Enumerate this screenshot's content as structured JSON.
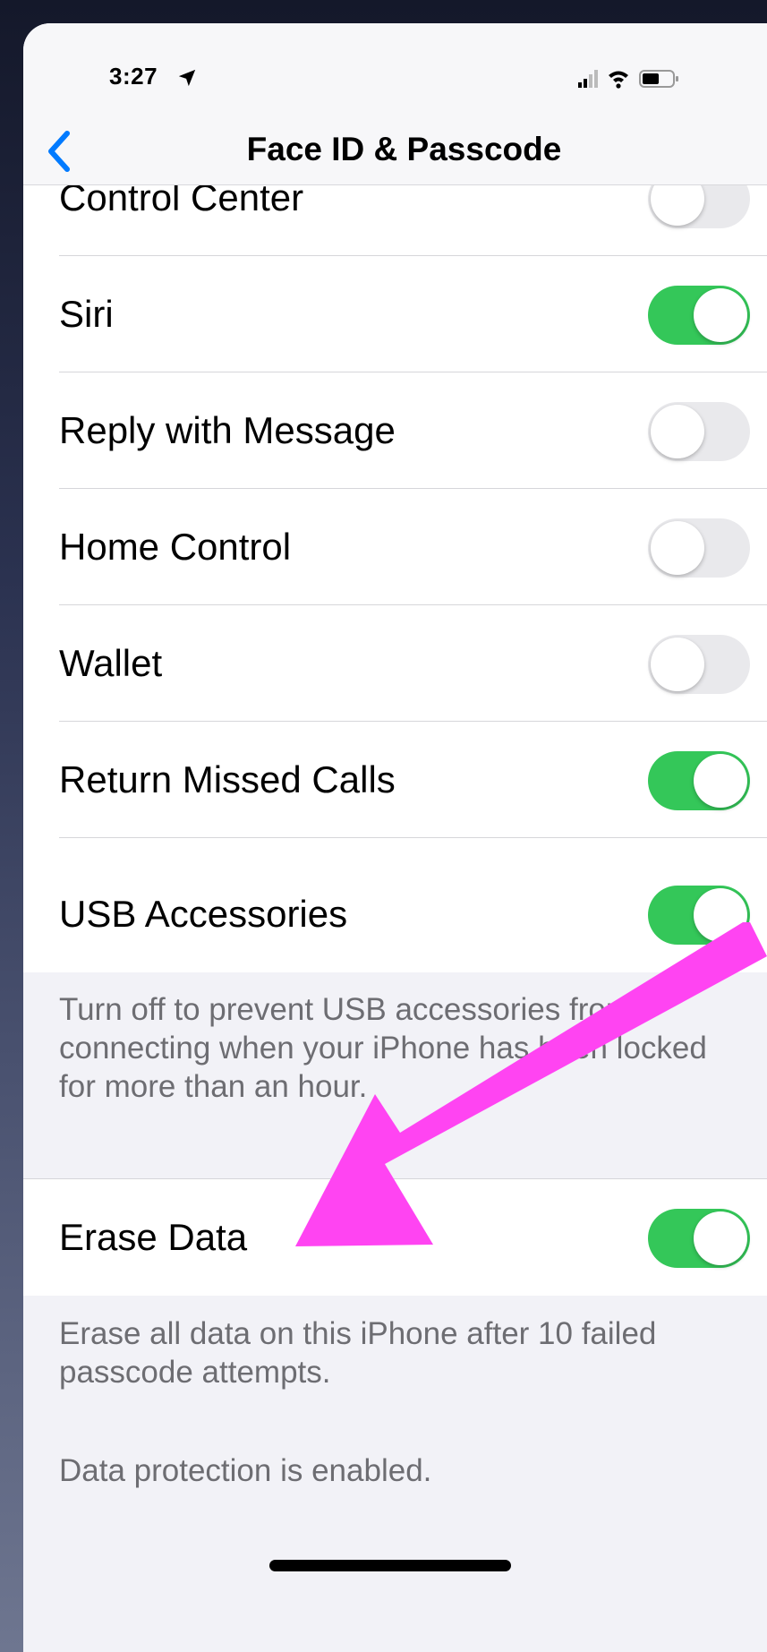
{
  "status_bar": {
    "time": "3:27",
    "icons": [
      "location-arrow-icon",
      "signal-bars-icon",
      "wifi-icon",
      "battery-icon"
    ]
  },
  "nav": {
    "title": "Face ID & Passcode",
    "back_icon": "chevron-left-icon"
  },
  "accent_colors": {
    "toggle_on": "#34c759",
    "toggle_off": "#e9e9ec",
    "back_chevron": "#007aff",
    "arrow_annotation": "#ff44f2"
  },
  "rows": [
    {
      "label": "Control Center",
      "on": false
    },
    {
      "label": "Siri",
      "on": true
    },
    {
      "label": "Reply with Message",
      "on": false
    },
    {
      "label": "Home Control",
      "on": false
    },
    {
      "label": "Wallet",
      "on": false
    },
    {
      "label": "Return Missed Calls",
      "on": true
    },
    {
      "label": "USB Accessories",
      "on": true
    }
  ],
  "usb_footer": "Turn off to prevent USB accessories from connecting when your iPhone has been locked for more than an hour.",
  "erase_row": {
    "label": "Erase Data",
    "on": true
  },
  "erase_footer": "Erase all data on this iPhone after 10 failed passcode attempts.",
  "protection_footer": "Data protection is enabled."
}
